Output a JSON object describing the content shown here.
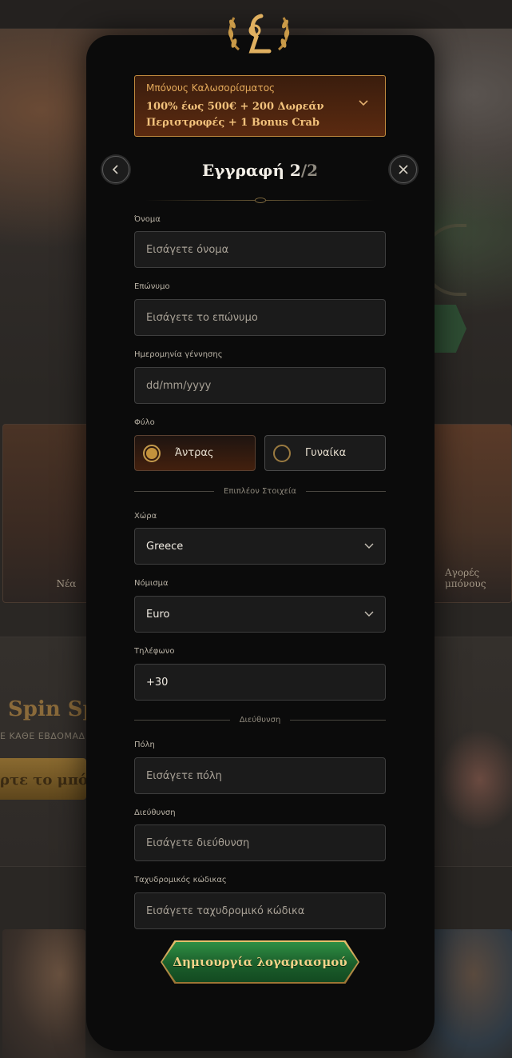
{
  "background": {
    "card_new_label": "Νέα",
    "card_bonus_label": "Αγορές μπόνους",
    "promo_title": "Spin Sp",
    "promo_subtitle": "Ε ΚΑΘΕ ΕΒΔΟΜΑΔ",
    "promo_button": "ρτε το μπό"
  },
  "bonus": {
    "title": "Μπόνους Καλωσορίσματος",
    "text": "100% έως 500€ + 200 Δωρεάν Περιστροφές + 1 Bonus Crab"
  },
  "header": {
    "title_prefix": "Εγγραφή 2",
    "title_total": "/2"
  },
  "form": {
    "first_name": {
      "label": "Όνομα",
      "placeholder": "Εισάγετε όνομα"
    },
    "last_name": {
      "label": "Επώνυμο",
      "placeholder": "Εισάγετε το επώνυμο"
    },
    "birth_date": {
      "label": "Ημερομηνία γέννησης",
      "placeholder": "dd/mm/yyyy"
    },
    "gender": {
      "label": "Φύλο",
      "options": [
        "Άντρας",
        "Γυναίκα"
      ],
      "selected": "Άντρας"
    },
    "extra_section": "Επιπλέον Στοιχεία",
    "country": {
      "label": "Χώρα",
      "value": "Greece"
    },
    "currency": {
      "label": "Νόμισμα",
      "value": "Euro"
    },
    "phone": {
      "label": "Τηλέφωνο",
      "value": "+30"
    },
    "address_section": "Διεύθυνση",
    "city": {
      "label": "Πόλη",
      "placeholder": "Εισάγετε πόλη"
    },
    "address": {
      "label": "Διεύθυνση",
      "placeholder": "Εισάγετε διεύθυνση"
    },
    "postal_code": {
      "label": "Ταχυδρομικός κώδικας",
      "placeholder": "Εισάγετε ταχυδρομικό κώδικα"
    }
  },
  "submit_label": "Δημιουργία λογαριασμού",
  "colors": {
    "accent_gold": "#c4923c",
    "cta_green": "#1b5e2b",
    "modal_bg": "#0b0b0b"
  },
  "icons": {
    "logo": "laurel-logo-icon",
    "back": "chevron-left-icon",
    "close": "close-icon",
    "expand": "chevron-down-icon"
  }
}
